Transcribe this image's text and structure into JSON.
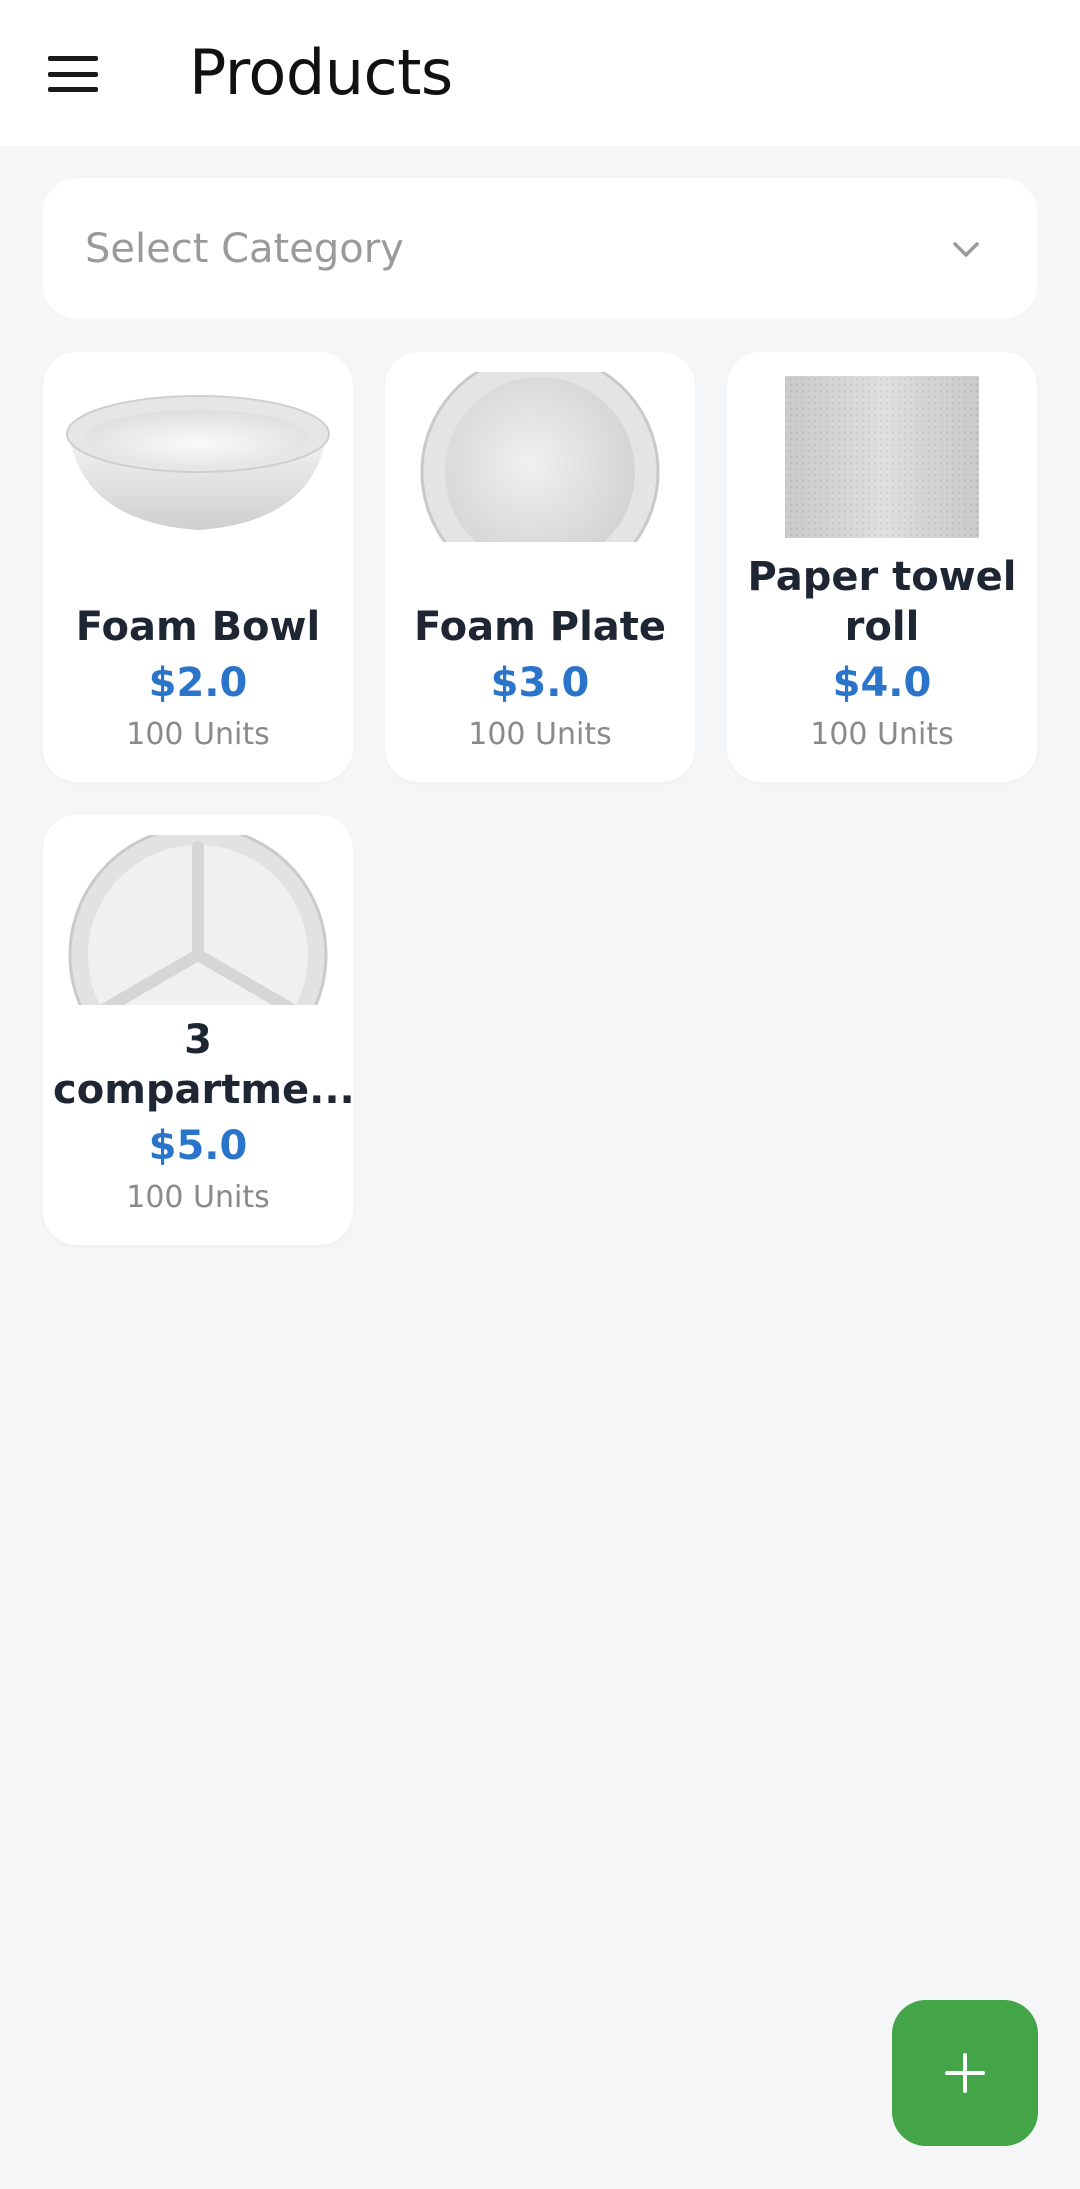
{
  "header": {
    "title": "Products",
    "menu_icon": "hamburger-menu-icon"
  },
  "category_select": {
    "placeholder": "Select Category",
    "icon": "chevron-down-icon"
  },
  "products": [
    {
      "name": "Foam Bowl",
      "price": "$2.0",
      "units": "100 Units",
      "image": "foam-bowl"
    },
    {
      "name": "Foam Plate",
      "price": "$3.0",
      "units": "100 Units",
      "image": "foam-plate"
    },
    {
      "name": "Paper towel\nroll",
      "price": "$4.0",
      "units": "100 Units",
      "image": "paper-towel-roll"
    },
    {
      "name": "3\ncompartme...",
      "price": "$5.0",
      "units": "100 Units",
      "image": "compartment-plate"
    }
  ],
  "fab": {
    "icon": "plus-icon",
    "color": "#43a547"
  },
  "colors": {
    "price": "#2a74c9",
    "background": "#f5f6f8"
  }
}
